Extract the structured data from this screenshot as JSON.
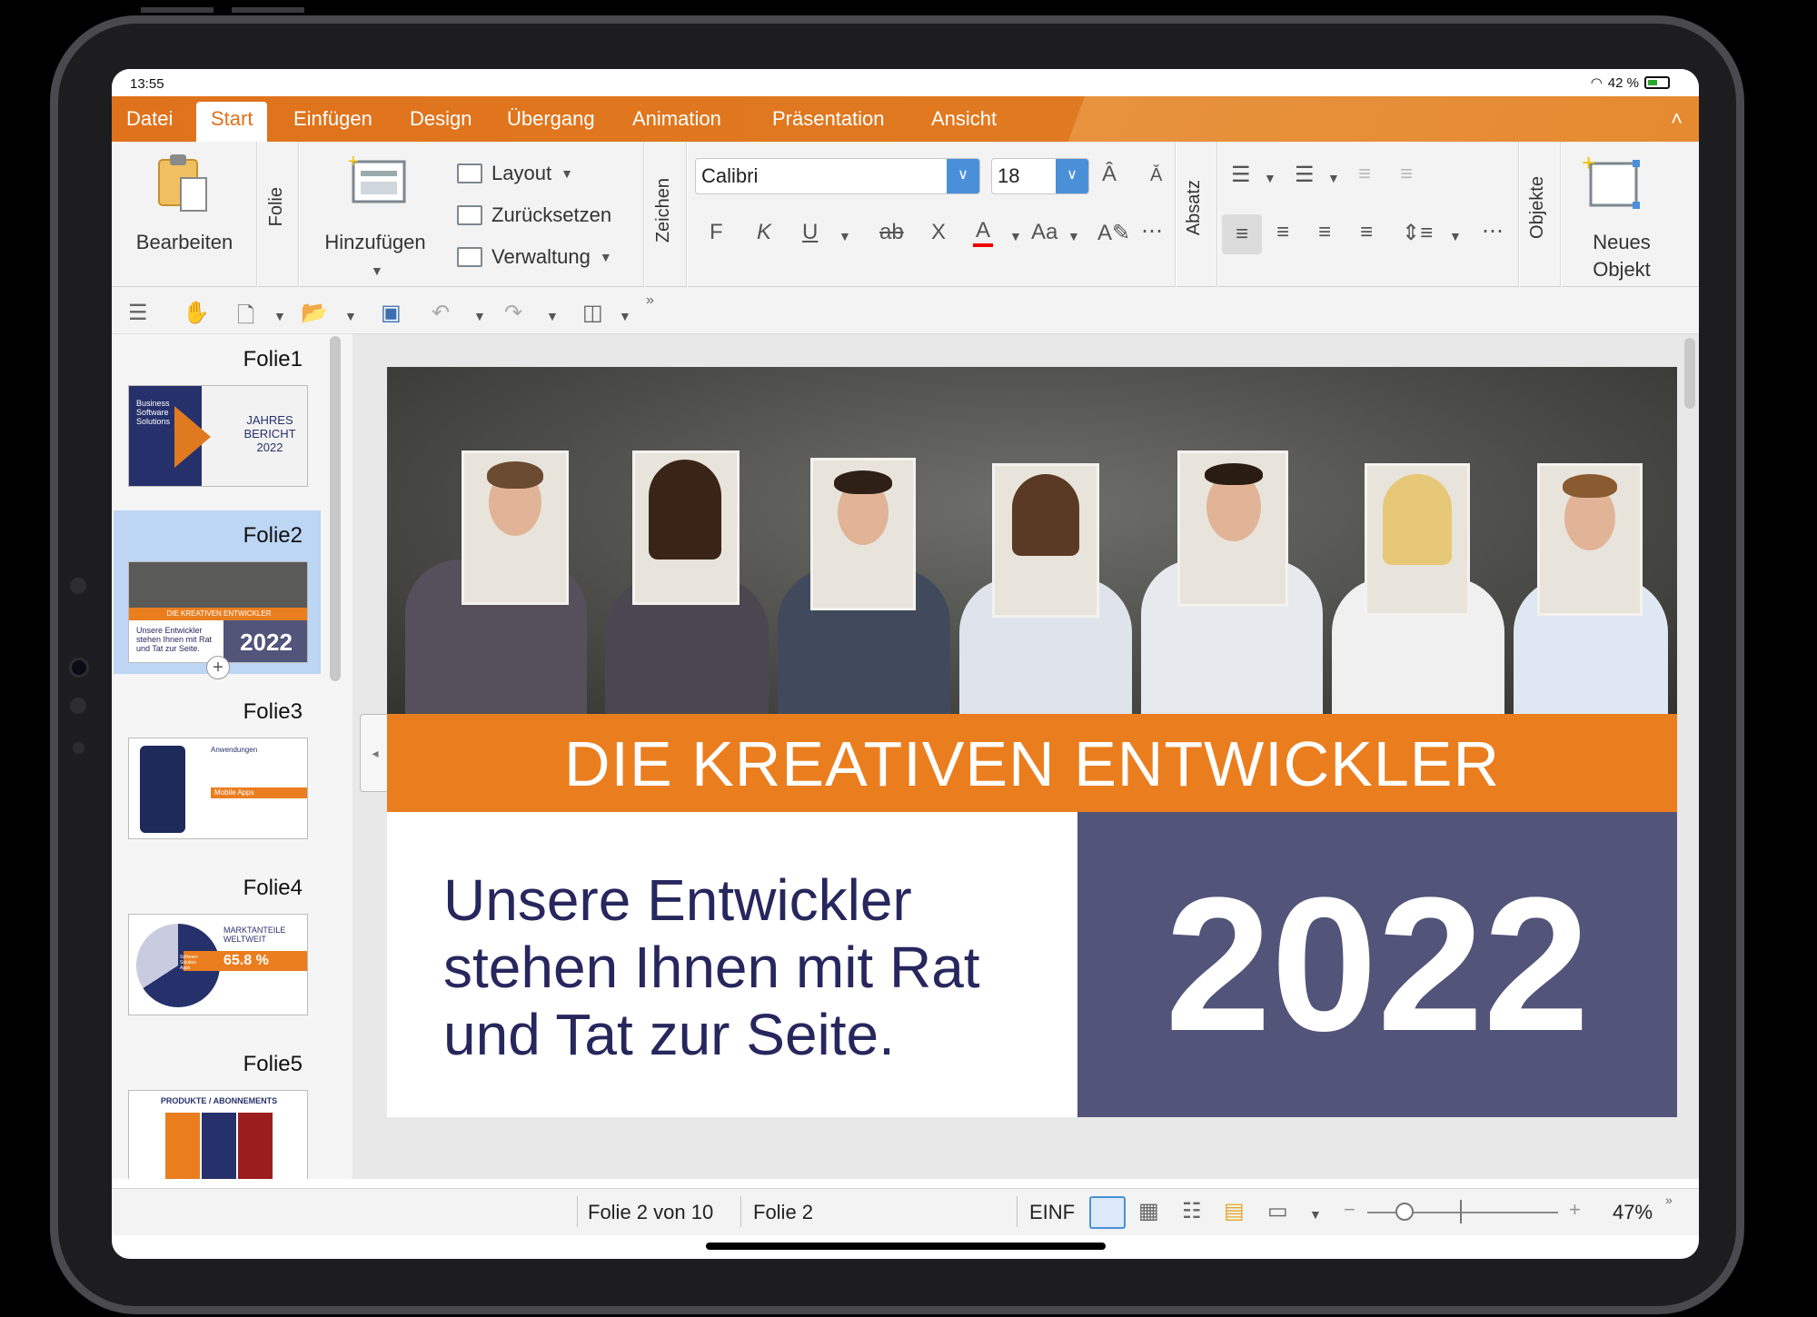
{
  "status": {
    "time": "13:55",
    "battery": "42 %"
  },
  "tabs": [
    "Datei",
    "Start",
    "Einfügen",
    "Design",
    "Übergang",
    "Animation",
    "Präsentation",
    "Ansicht"
  ],
  "active_tab": "Start",
  "ribbon": {
    "edit_label": "Bearbeiten",
    "group_folie": "Folie",
    "add_label": "Hinzufügen",
    "layout_label": "Layout",
    "reset_label": "Zurücksetzen",
    "manage_label": "Verwaltung",
    "group_zeichen": "Zeichen",
    "font_name": "Calibri",
    "font_size": "18",
    "bold_label": "F",
    "italic_label": "K",
    "underline_label": "U",
    "strike_label": "ab",
    "clear_label": "X",
    "color_label": "A",
    "case_label": "Aa",
    "group_absatz": "Absatz",
    "group_objekte": "Objekte",
    "new_object_line1": "Neues",
    "new_object_line2": "Objekt"
  },
  "slides": [
    {
      "label": "Folie1",
      "thumb_title": "JAHRES BERICHT 2022",
      "thumb_sub": "Business Software Solutions"
    },
    {
      "label": "Folie2",
      "thumb_title": "DIE KREATIVEN ENTWICKLER",
      "thumb_sub": "Unsere Entwickler stehen Ihnen mit Rat und Tat zur Seite.",
      "thumb_year": "2022"
    },
    {
      "label": "Folie3",
      "thumb_title": "Anwendungen",
      "thumb_sub": "Mobile Apps"
    },
    {
      "label": "Folie4",
      "thumb_title": "MARKTANTEILE WELTWEIT",
      "thumb_sub": "65.8 %",
      "thumb_note": "Software Solution Apps"
    },
    {
      "label": "Folie5",
      "thumb_title": "PRODUKTE / ABONNEMENTS"
    }
  ],
  "slide": {
    "banner": "DIE KREATIVEN ENTWICKLER",
    "subtitle": "Unsere Entwickler stehen Ihnen mit Rat und Tat zur Seite.",
    "year": "2022"
  },
  "bottom": {
    "position": "Folie 2 von 10",
    "slide_name": "Folie 2",
    "mode": "EINF",
    "zoom": "47%",
    "zoom_minus": "−",
    "zoom_plus": "+"
  },
  "colors": {
    "accent": "#e0721c",
    "slide_orange": "#ea7e1f",
    "slide_purple": "#525479",
    "slide_text": "#27275e"
  }
}
